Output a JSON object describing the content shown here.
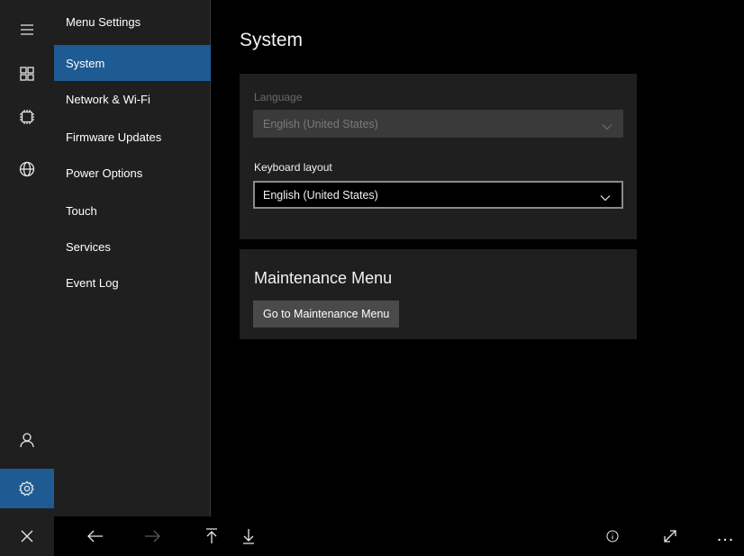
{
  "rail": {
    "items": [
      {
        "icon": "hamburger-icon"
      },
      {
        "icon": "apps-grid-icon"
      },
      {
        "icon": "chip-icon"
      },
      {
        "icon": "globe-icon"
      },
      {
        "icon": "person-icon"
      },
      {
        "icon": "gear-icon",
        "active": true
      }
    ]
  },
  "menu": {
    "header": "Menu Settings",
    "items": [
      {
        "label": "System",
        "active": true
      },
      {
        "label": "Network & Wi-Fi"
      },
      {
        "label": "Firmware Updates"
      },
      {
        "label": "Power Options"
      },
      {
        "label": "Touch"
      },
      {
        "label": "Services"
      },
      {
        "label": "Event Log"
      }
    ]
  },
  "main": {
    "title": "System",
    "language": {
      "label": "Language",
      "value": "English (United States)",
      "disabled": true
    },
    "keyboard": {
      "label": "Keyboard layout",
      "value": "English (United States)"
    },
    "maintenance": {
      "title": "Maintenance Menu",
      "button_label": "Go to Maintenance Menu"
    }
  },
  "bottom_bar": {
    "icons": [
      "close-icon",
      "back-arrow-icon",
      "forward-arrow-icon",
      "scroll-top-icon",
      "scroll-bottom-icon",
      "info-icon",
      "expand-icon",
      "more-icon"
    ]
  },
  "colors": {
    "accent": "#1e5b93",
    "pane": "#1f1f1f",
    "background": "#000000"
  }
}
